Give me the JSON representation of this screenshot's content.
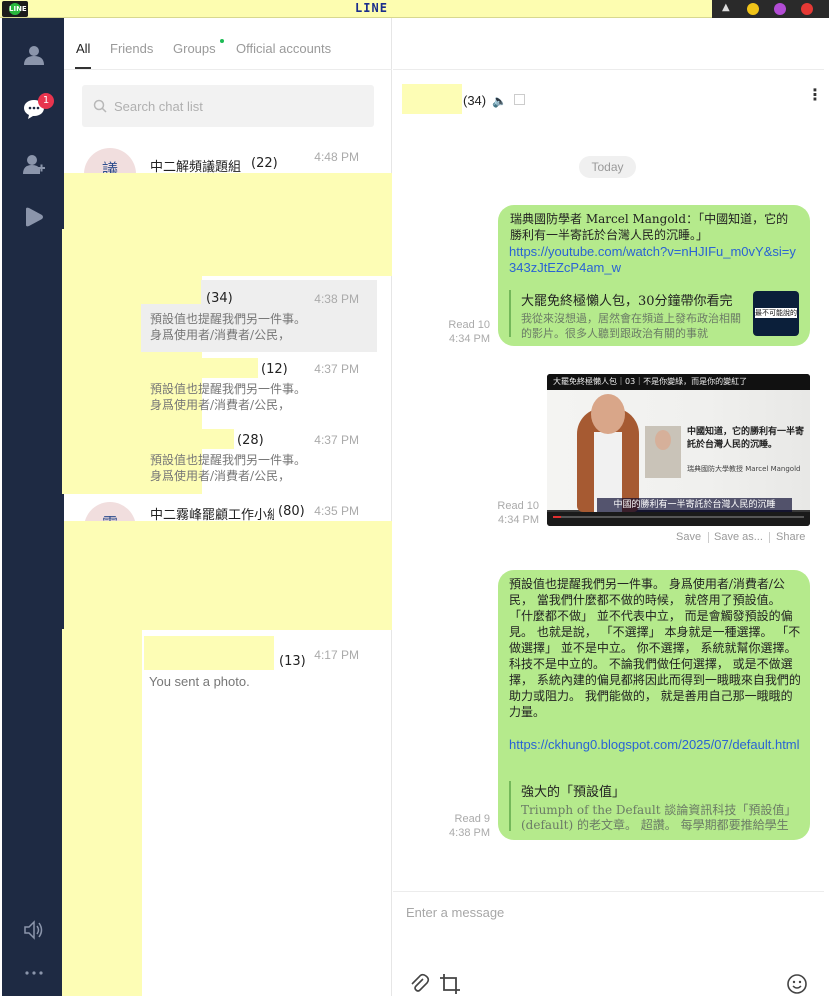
{
  "window": {
    "title": "LINE"
  },
  "sidebar": {
    "unread_badge": "1"
  },
  "tabs": [
    "All",
    "Friends",
    "Groups",
    "Official accounts"
  ],
  "search": {
    "placeholder": "Search chat list"
  },
  "chat_list": [
    {
      "avatar_text": "議",
      "name": "中二解頻議題組",
      "count": "(22)",
      "time": "4:48 PM",
      "preview": ""
    },
    {
      "avatar_text": "",
      "name": "",
      "count": "(34)",
      "time": "4:38 PM",
      "preview": "預設值也提醒我們另一件事。 身爲使用者/消費者/公民，"
    },
    {
      "avatar_text": "",
      "name": "",
      "count": "(12)",
      "time": "4:37 PM",
      "preview": "預設值也提醒我們另一件事。 身爲使用者/消費者/公民，"
    },
    {
      "avatar_text": "",
      "name": "",
      "count": "(28)",
      "time": "4:37 PM",
      "preview": "預設值也提醒我們另一件事。 身爲使用者/消費者/公民，"
    },
    {
      "avatar_text": "霧",
      "name": "中二霧峰罷顧工作小組",
      "count": "(80)",
      "time": "4:35 PM",
      "preview": ""
    },
    {
      "avatar_text": "",
      "name": "",
      "count": "(13)",
      "time": "4:17 PM",
      "preview": "You sent a photo."
    }
  ],
  "chat": {
    "member_count": "(34)",
    "date_separator": "Today",
    "messages": [
      {
        "text": "瑞典國防學者 Marcel Mangold：「中國知道，它的勝利有一半寄託於台灣人民的沉睡。」",
        "link": "https://youtube.com/watch?v=nHJIFu_m0vY&si=y343zJtEZcP4am_w",
        "preview_title": "大罷免終極懶人包，30分鐘帶你看完",
        "preview_desc": "我從來沒想過，居然會在頻道上發布政治相關的影片。很多人聽到跟政治有關的事就",
        "thumb_text": "最不可能說的",
        "read": "Read 10",
        "time": "4:34 PM"
      },
      {
        "photo_top": "大罷免終極懶人包｜03｜不是你變綠，而是你的變紅了",
        "photo_quote": "中國知道，它的勝利有一半寄託於台灣人民的沉睡。",
        "photo_credit": "瑞典國防大學教授 Marcel Mangold",
        "photo_subtitle": "中國的勝利有一半寄託於台灣人民的沉睡",
        "read": "Read 10",
        "time": "4:34 PM",
        "actions": [
          "Save",
          "Save as...",
          "Share"
        ]
      },
      {
        "text": "預設值也提醒我們另一件事。 身爲使用者/消費者/公民， 當我們什麼都不做的時候， 就啓用了預設值。 「什麼都不做」 並不代表中立， 而是會觸發預設的偏見。 也就是說， 「不選擇」 本身就是一種選擇。 「不做選擇」 並不是中立。 你不選擇， 系統就幫你選擇。 科技不是中立的。 不論我們做任何選擇， 或是不做選擇， 系統內建的偏見都將因此而得到一睋睋來自我們的助力或阻力。 我們能做的， 就是善用自己那一睋睋的力量。",
        "link": "https://ckhung0.blogspot.com/2025/07/default.html",
        "preview_title": "強大的「預設值」",
        "preview_desc": "Triumph of the Default 談論資訊科技「預設值」(default) 的老文章。 超讚。 每學期都要推給學生",
        "read": "Read 9",
        "time": "4:38 PM"
      }
    ],
    "composer_placeholder": "Enter a message"
  },
  "colors": {
    "sidebar": "#1e2a43",
    "bubble": "#b5ea8c",
    "link": "#2a63d4",
    "badge": "#e8344e",
    "redaction": "#fdfdb5"
  }
}
